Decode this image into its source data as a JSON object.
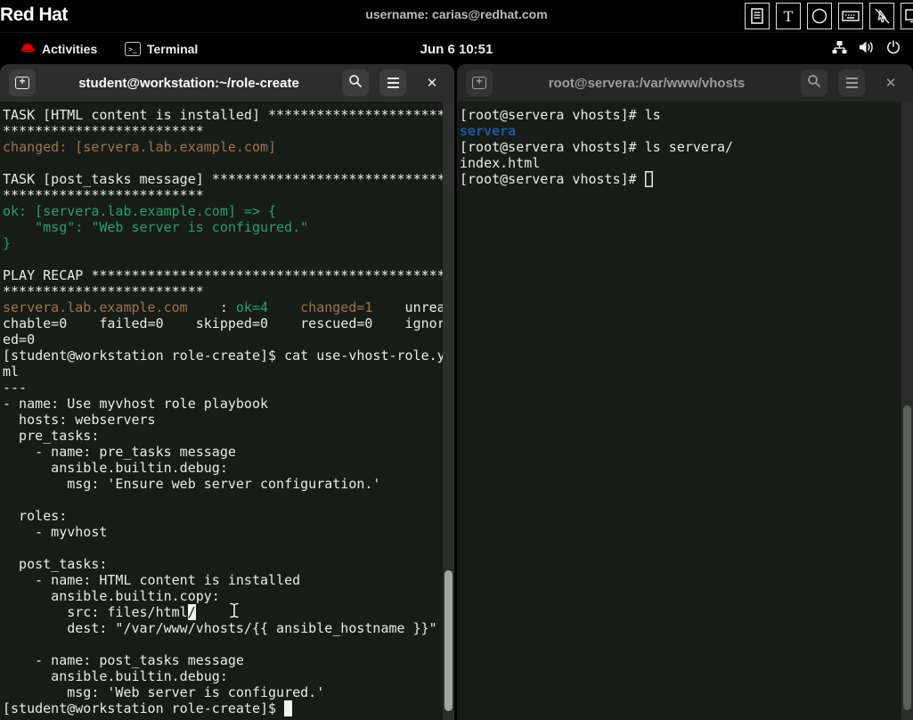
{
  "console_bar": {
    "logo": "Red Hat",
    "username": "username: carias@redhat.com",
    "toolbar_icons": [
      "document-icon",
      "text-icon",
      "circle-icon",
      "keyboard-icon",
      "pointer-disabled-icon",
      "monitor-icon"
    ]
  },
  "top_bar": {
    "activities_label": "Activities",
    "app_label": "Terminal",
    "clock": "Jun 6  10:51",
    "status_icons": [
      "network-icon",
      "volume-icon",
      "power-icon"
    ]
  },
  "colors": {
    "terminal_bg": "#171c17",
    "terminal_fg": "#ebebe9",
    "ansible_changed_orange": "#a2734c",
    "ansible_ok_green": "#26a269",
    "directory_blue": "#1c57a5",
    "redhat_red": "#e00",
    "headerbar_focused": "#2d2d2d",
    "headerbar_unfocused": "#272727"
  },
  "left_terminal": {
    "title": "student@workstation:~/role-create",
    "lines": [
      [
        [
          "fg",
          "TASK [HTML content is installed] **********************"
        ]
      ],
      [
        [
          "fg",
          "*************************"
        ]
      ],
      [
        [
          "or",
          "changed: [servera.lab.example.com]"
        ]
      ],
      [],
      [
        [
          "fg",
          "TASK [post_tasks message] *****************************"
        ]
      ],
      [
        [
          "fg",
          "*************************"
        ]
      ],
      [
        [
          "gr",
          "ok: [servera.lab.example.com] => {"
        ]
      ],
      [
        [
          "gr",
          "    \"msg\": \"Web server is configured.\""
        ]
      ],
      [
        [
          "gr",
          "}"
        ]
      ],
      [],
      [
        [
          "fg",
          "PLAY RECAP ********************************************"
        ]
      ],
      [
        [
          "fg",
          "*************************"
        ]
      ],
      [
        [
          "or",
          "servera.lab.example.com"
        ],
        [
          "fg",
          "    : "
        ],
        [
          "gr",
          "ok=4"
        ],
        [
          "fg",
          "    "
        ],
        [
          "or",
          "changed=1"
        ],
        [
          "fg",
          "    unrea"
        ]
      ],
      [
        [
          "fg",
          "chable=0    failed=0    skipped=0    rescued=0    ignor"
        ]
      ],
      [
        [
          "fg",
          "ed=0"
        ]
      ],
      [
        [
          "fg",
          "[student@workstation role-create]$ cat use-vhost-role.y"
        ]
      ],
      [
        [
          "fg",
          "ml"
        ]
      ],
      [
        [
          "fg",
          "---"
        ]
      ],
      [
        [
          "fg",
          "- name: Use myvhost role playbook"
        ]
      ],
      [
        [
          "fg",
          "  hosts: webservers"
        ]
      ],
      [
        [
          "fg",
          "  pre_tasks:"
        ]
      ],
      [
        [
          "fg",
          "    - name: pre_tasks message"
        ]
      ],
      [
        [
          "fg",
          "      ansible.builtin.debug:"
        ]
      ],
      [
        [
          "fg",
          "        msg: 'Ensure web server configuration.'"
        ]
      ],
      [],
      [
        [
          "fg",
          "  roles:"
        ]
      ],
      [
        [
          "fg",
          "    - myvhost"
        ]
      ],
      [],
      [
        [
          "fg",
          "  post_tasks:"
        ]
      ],
      [
        [
          "fg",
          "    - name: HTML content is installed"
        ]
      ],
      [
        [
          "fg",
          "      ansible.builtin.copy:"
        ]
      ],
      [
        [
          "fg",
          "        src: files/html"
        ],
        [
          "sel",
          "/"
        ]
      ],
      [
        [
          "fg",
          "        dest: \"/var/www/vhosts/{{ ansible_hostname }}\""
        ]
      ],
      [],
      [
        [
          "fg",
          "    - name: post_tasks message"
        ]
      ],
      [
        [
          "fg",
          "      ansible.builtin.debug:"
        ]
      ],
      [
        [
          "fg",
          "        msg: 'Web server is configured.'"
        ]
      ],
      [
        [
          "fg",
          "[student@workstation role-create]$ "
        ],
        [
          "cur",
          " "
        ]
      ]
    ]
  },
  "right_terminal": {
    "title": "root@servera:/var/www/vhosts",
    "lines": [
      [
        [
          "fg",
          "[root@servera vhosts]# ls"
        ]
      ],
      [
        [
          "bl",
          "servera"
        ]
      ],
      [
        [
          "fg",
          "[root@servera vhosts]# ls servera/"
        ]
      ],
      [
        [
          "fg",
          "index.html"
        ]
      ],
      [
        [
          "fg",
          "[root@servera vhosts]# "
        ],
        [
          "hcur",
          " "
        ]
      ]
    ]
  }
}
